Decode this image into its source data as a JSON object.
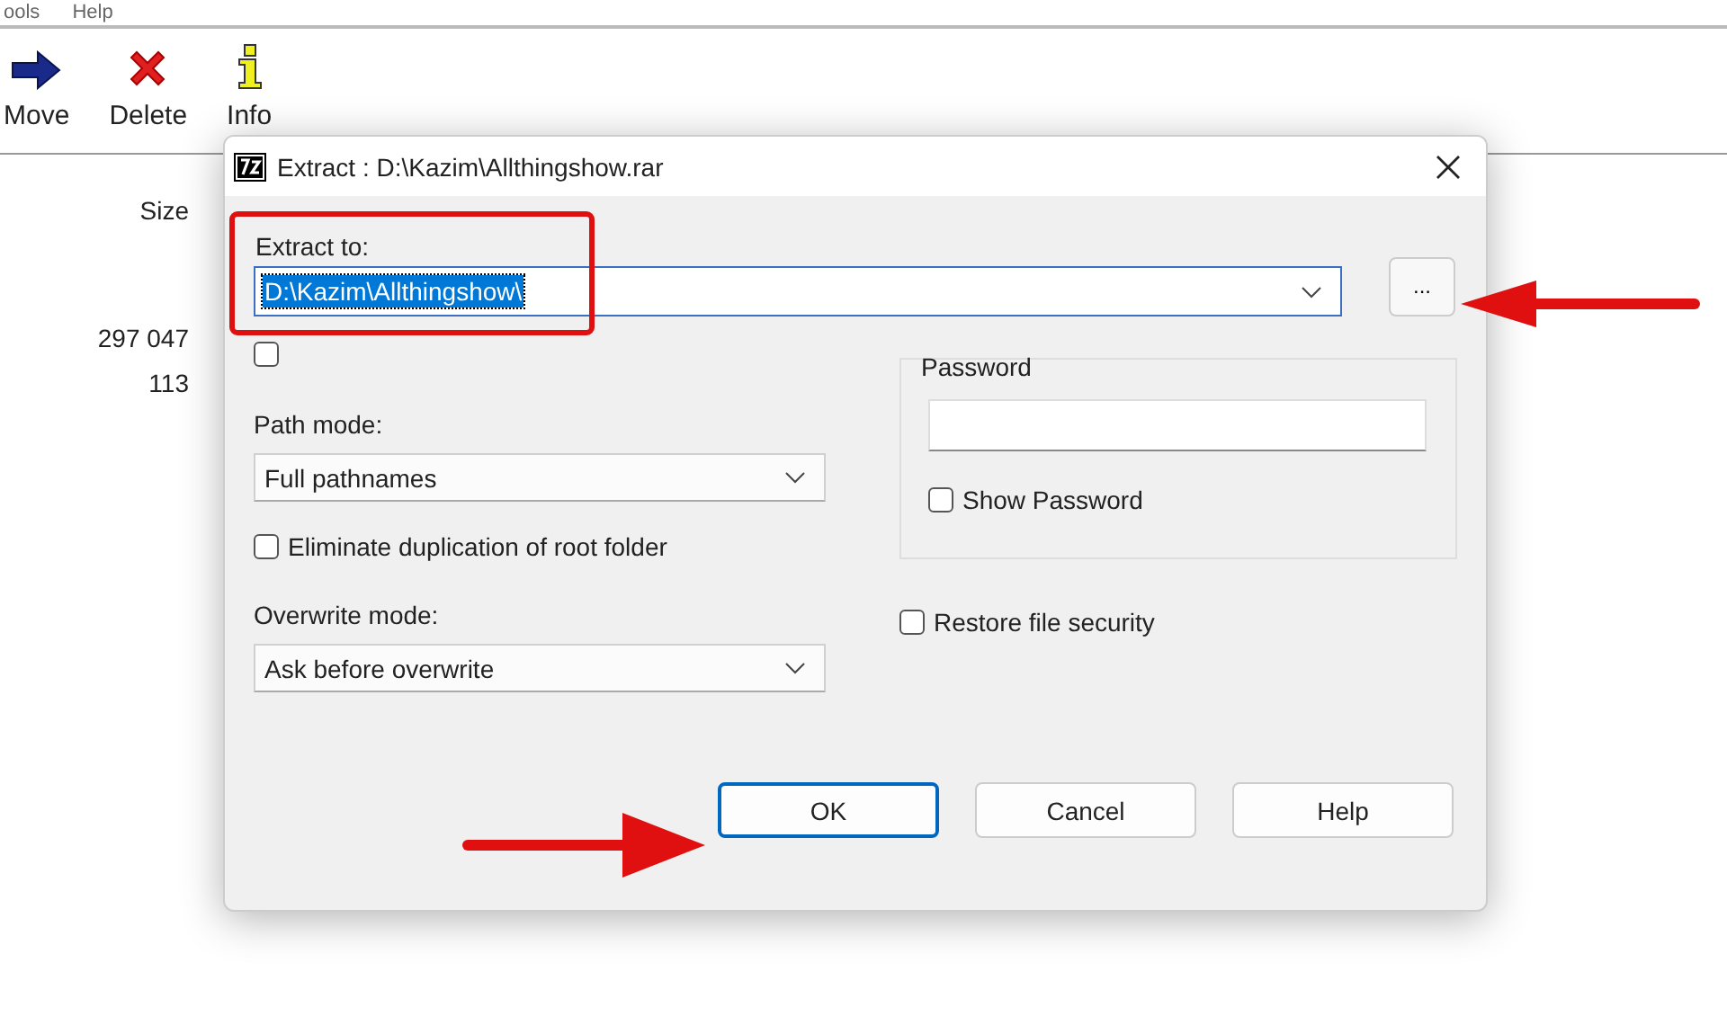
{
  "menu": [
    "ools",
    "Help"
  ],
  "toolbar": [
    {
      "label": "Move",
      "kind": "move"
    },
    {
      "label": "Delete",
      "kind": "delete"
    },
    {
      "label": "Info",
      "kind": "info"
    }
  ],
  "file_list": {
    "columns": [
      "Size"
    ],
    "sizes": [
      "297 047",
      "113"
    ]
  },
  "dialog": {
    "title": "Extract : D:\\Kazim\\Allthingshow.rar",
    "extract_to": {
      "label": "Extract to:",
      "value": "D:\\Kazim\\Allthingshow\\",
      "value_selected": true
    },
    "browse_button": "...",
    "extra_checkbox": {
      "checked": false
    },
    "path_mode": {
      "label": "Path mode:",
      "value": "Full pathnames"
    },
    "eliminate_duplication": {
      "label": "Eliminate duplication of root folder",
      "checked": false
    },
    "overwrite_mode": {
      "label": "Overwrite mode:",
      "value": "Ask before overwrite"
    },
    "password": {
      "group_label": "Password",
      "show_password": {
        "label": "Show Password",
        "checked": false
      }
    },
    "restore_security": {
      "label": "Restore file security",
      "checked": false
    },
    "buttons": [
      {
        "label": "OK",
        "default": true
      },
      {
        "label": "Cancel",
        "default": false
      },
      {
        "label": "Help",
        "default": false
      }
    ]
  }
}
